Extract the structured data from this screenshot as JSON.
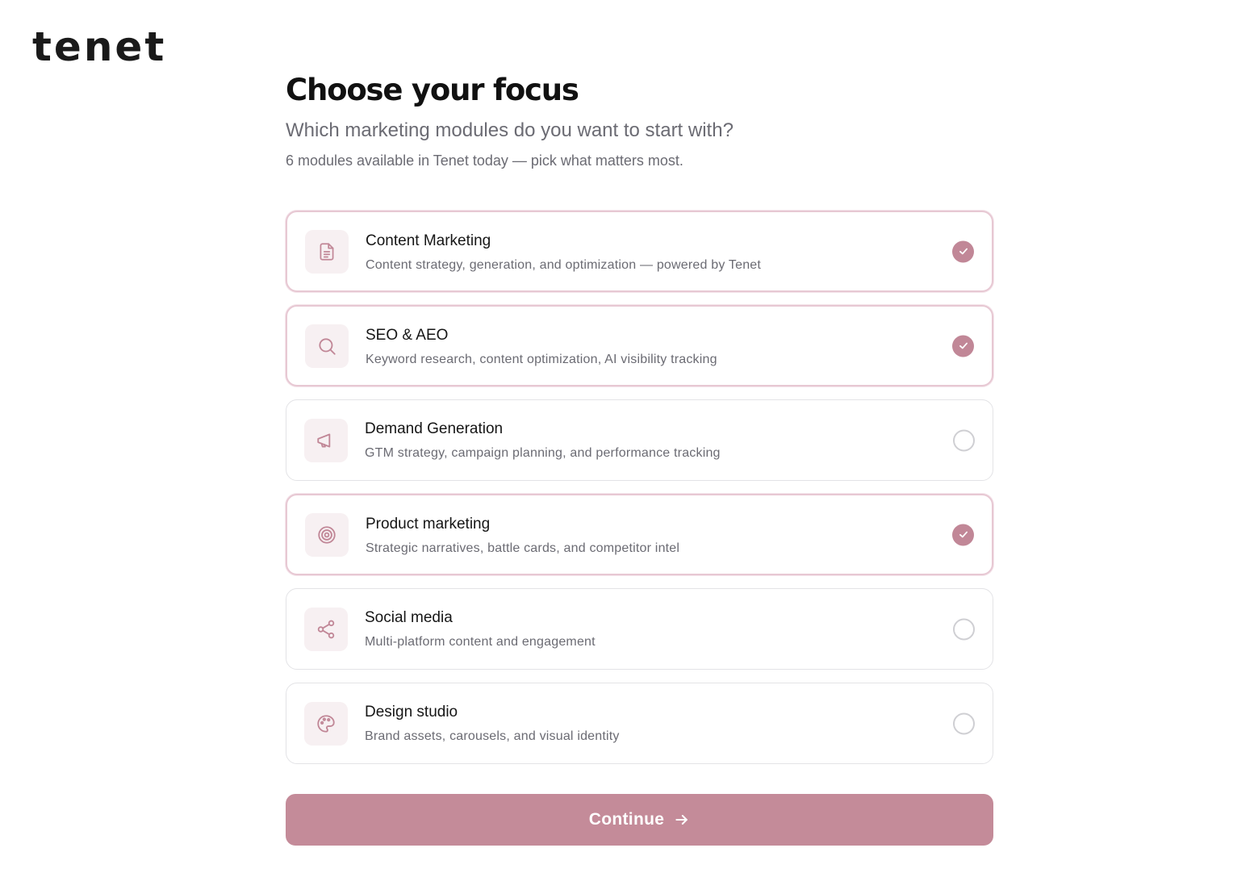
{
  "brand": {
    "logo_text": "tenet"
  },
  "header": {
    "title": "Choose your focus",
    "subtitle": "Which marketing modules do you want to start with?",
    "note": "6 modules available in Tenet today — pick what matters most."
  },
  "accent_color": "#c18797",
  "modules": [
    {
      "title": "Content Marketing",
      "description": "Content strategy, generation, and optimization — powered by Tenet",
      "icon": "document-icon",
      "selected": true
    },
    {
      "title": "SEO & AEO",
      "description": "Keyword research, content optimization, AI visibility tracking",
      "icon": "search-icon",
      "selected": true
    },
    {
      "title": "Demand Generation",
      "description": "GTM strategy, campaign planning, and performance tracking",
      "icon": "megaphone-icon",
      "selected": false
    },
    {
      "title": "Product marketing",
      "description": "Strategic narratives, battle cards, and competitor intel",
      "icon": "target-icon",
      "selected": true
    },
    {
      "title": "Social media",
      "description": "Multi-platform content and engagement",
      "icon": "share-icon",
      "selected": false
    },
    {
      "title": "Design studio",
      "description": "Brand assets, carousels, and visual identity",
      "icon": "palette-icon",
      "selected": false
    }
  ],
  "actions": {
    "continue_label": "Continue"
  }
}
